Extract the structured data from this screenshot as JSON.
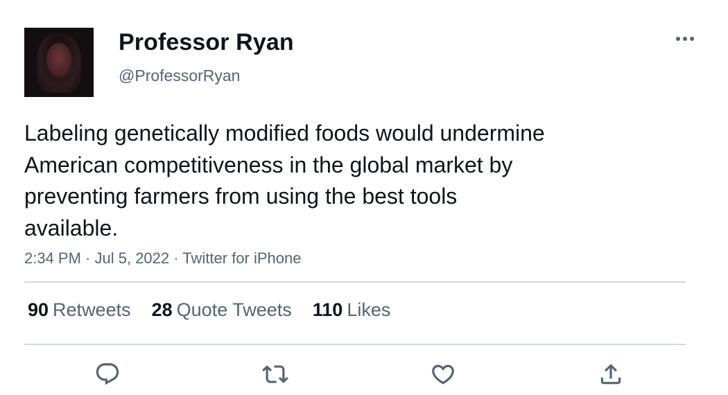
{
  "user": {
    "display_name": "Professor Ryan",
    "handle": "@ProfessorRyan"
  },
  "tweet": {
    "text_lines": [
      "Labeling genetically modified foods would undermine",
      "American competitiveness in the global market by",
      "preventing farmers from using the best tools",
      "available."
    ],
    "time": "2:34 PM",
    "date": "Jul 5, 2022",
    "source": "Twitter for iPhone",
    "separator": " · "
  },
  "stats": {
    "retweets": {
      "count": "90",
      "label": "Retweets"
    },
    "quotes": {
      "count": "28",
      "label": "Quote Tweets"
    },
    "likes": {
      "count": "110",
      "label": "Likes"
    }
  },
  "icons": {
    "more": "more-dots-icon",
    "reply": "reply-icon",
    "retweet": "retweet-icon",
    "like": "heart-icon",
    "share": "share-icon"
  },
  "colors": {
    "text_primary": "#0f1419",
    "text_secondary": "#536471",
    "divider": "#cfd9de"
  }
}
